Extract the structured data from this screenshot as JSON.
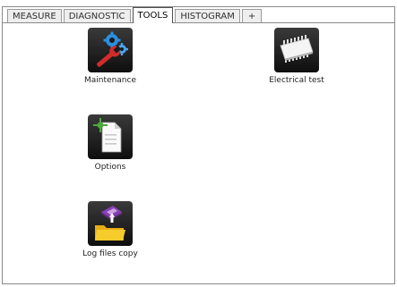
{
  "tabs": [
    {
      "label": "MEASURE",
      "active": false
    },
    {
      "label": "DIAGNOSTIC",
      "active": false
    },
    {
      "label": "TOOLS",
      "active": true
    },
    {
      "label": "HISTOGRAM",
      "active": false
    },
    {
      "label": "+",
      "active": false
    }
  ],
  "tools": [
    {
      "label": "Maintenance",
      "icon": "maintenance-icon"
    },
    {
      "label": "Electrical test",
      "icon": "chip-icon"
    },
    {
      "label": "Options",
      "icon": "options-document-icon"
    },
    {
      "label": "Log files copy",
      "icon": "log-files-copy-icon"
    }
  ],
  "colors": {
    "icon_background": "#1a1a1a",
    "wrench_red": "#d12b2b",
    "gear_blue": "#2b8fe0",
    "folder_yellow": "#f2c21b",
    "accent_purple": "#8a3fb5"
  }
}
